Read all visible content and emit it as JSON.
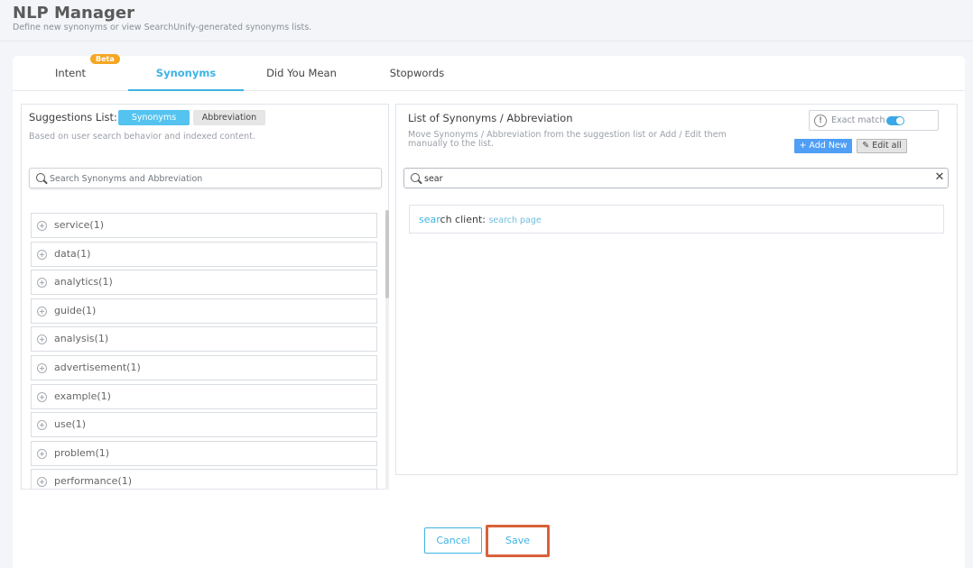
{
  "header": {
    "title": "NLP Manager",
    "subtitle": "Define new synonyms or view SearchUnify-generated synonyms lists."
  },
  "tabs": [
    {
      "label": "Intent",
      "badge": "Beta"
    },
    {
      "label": "Synonyms",
      "active": true
    },
    {
      "label": "Did You Mean"
    },
    {
      "label": "Stopwords"
    }
  ],
  "suggestions": {
    "label": "Suggestions List:",
    "toggle_synonyms": "Synonyms",
    "toggle_abbreviation": "Abbreviation",
    "description": "Based on user search behavior and indexed content.",
    "search_placeholder": "Search Synonyms and Abbreviation",
    "items": [
      {
        "label": "service(1)"
      },
      {
        "label": "data(1)"
      },
      {
        "label": "analytics(1)"
      },
      {
        "label": "guide(1)"
      },
      {
        "label": "analysis(1)"
      },
      {
        "label": "advertisement(1)"
      },
      {
        "label": "example(1)"
      },
      {
        "label": "use(1)"
      },
      {
        "label": "problem(1)"
      },
      {
        "label": "performance(1)"
      }
    ]
  },
  "synonyms_list": {
    "title": "List of Synonyms / Abbreviation",
    "description": "Move Synonyms / Abbreviation from the suggestion list or Add / Edit them manually to the list.",
    "exact_match_label": "Exact match",
    "exact_match_on": true,
    "add_new_label": "+ Add New",
    "edit_all_label": "Edit all",
    "search_value": "sear",
    "results": [
      {
        "term_match": "sear",
        "term_rest": "ch client:",
        "value": "search page"
      }
    ]
  },
  "footer": {
    "cancel_label": "Cancel",
    "save_label": "Save"
  },
  "colors": {
    "accent": "#3fb3e3",
    "beta_badge": "#f5a623",
    "add_button": "#4f9ff6",
    "save_highlight": "#d9613a"
  }
}
